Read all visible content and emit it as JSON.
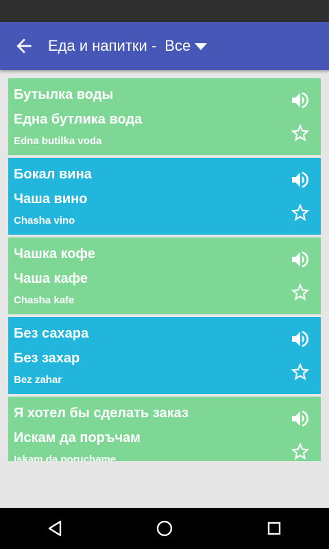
{
  "header": {
    "title": "Еда и напитки -",
    "filter": "Все"
  },
  "cards": [
    {
      "source": "Бутылка воды",
      "target": "Една бутлика вода",
      "translit": "Edna butilka voda",
      "color": "#7fd795"
    },
    {
      "source": "Бокал вина",
      "target": "Чаша вино",
      "translit": "Chasha vino",
      "color": "#22b6dd"
    },
    {
      "source": "Чашка кофе",
      "target": "Чаша кафе",
      "translit": "Chasha kafe",
      "color": "#7fd795"
    },
    {
      "source": "Без сахара",
      "target": "Без захар",
      "translit": "Bez zahar",
      "color": "#22b6dd"
    },
    {
      "source": "Я хотел бы сделать заказ",
      "target": "Искам да поръчам",
      "translit": "Iskam da poruchame",
      "color": "#7fd795"
    }
  ],
  "icons": {
    "back": "arrow-back-icon",
    "filter": "caret-down-icon",
    "speaker": "speaker-icon",
    "star": "star-outline-icon",
    "nav": [
      "nav-back-icon",
      "nav-home-icon",
      "nav-recents-icon"
    ]
  },
  "colors": {
    "app_bar": "#4757b8",
    "card_green": "#7fd795",
    "card_blue": "#22b6dd",
    "background": "#e6e6e6"
  }
}
